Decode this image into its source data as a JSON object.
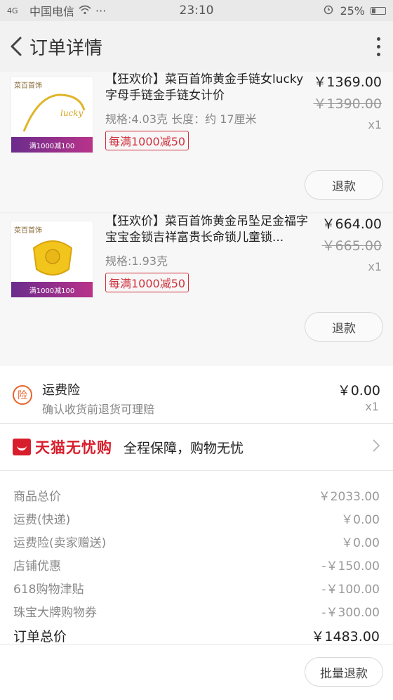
{
  "status": {
    "carrier": "中国电信",
    "time": "23:10",
    "battery": "25%",
    "signal": "4G",
    "dots": "···"
  },
  "header": {
    "title": "订单详情"
  },
  "items": [
    {
      "thumb_brand": "菜百首饰",
      "thumb_banner": "满1000减100",
      "name": "【狂欢价】菜百首饰黄金手链女lucky字母手链金手链女计价",
      "spec": "规格:4.03克  长度：约 17厘米",
      "promo": "每满1000减50",
      "price": "￥1369.00",
      "orig_price": "￥1390.00",
      "qty": "x1",
      "refund": "退款"
    },
    {
      "thumb_brand": "菜百首饰",
      "thumb_banner": "满1000减100",
      "name": "【狂欢价】菜百首饰黄金吊坠足金福字宝宝金锁吉祥富贵长命锁儿童锁...",
      "spec": "规格:1.93克",
      "promo": "每满1000减50",
      "price": "￥664.00",
      "orig_price": "￥665.00",
      "qty": "x1",
      "refund": "退款"
    }
  ],
  "insurance": {
    "icon_text": "险",
    "title": "运费险",
    "desc": "确认收货前退货可理赔",
    "price": "￥0.00",
    "qty": "x1"
  },
  "tmall": {
    "brand": "天猫无忧购",
    "slogan": "全程保障，购物无忧"
  },
  "summary": [
    {
      "label": "商品总价",
      "value": "￥2033.00"
    },
    {
      "label": "运费(快递)",
      "value": "￥0.00"
    },
    {
      "label": "运费险(卖家赠送)",
      "value": "￥0.00"
    },
    {
      "label": "店铺优惠",
      "value": "-￥150.00"
    },
    {
      "label": "618购物津贴",
      "value": "-￥100.00"
    },
    {
      "label": "珠宝大牌购物券",
      "value": "-￥300.00"
    }
  ],
  "total": {
    "label": "订单总价",
    "value": "￥1483.00"
  },
  "bottom": {
    "batch_refund": "批量退款"
  }
}
